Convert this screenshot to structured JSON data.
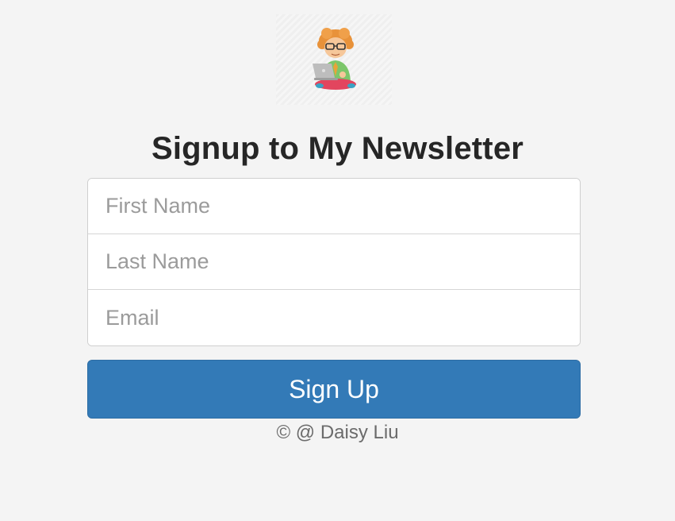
{
  "logo": {
    "icon": "person-with-laptop-avatar"
  },
  "title": "Signup to My Newsletter",
  "form": {
    "first_name_placeholder": "First Name",
    "last_name_placeholder": "Last Name",
    "email_placeholder": "Email",
    "submit_label": "Sign Up"
  },
  "footer": "© @ Daisy Liu",
  "colors": {
    "background": "#f4f4f4",
    "button": "#337ab7",
    "title": "#262626"
  }
}
